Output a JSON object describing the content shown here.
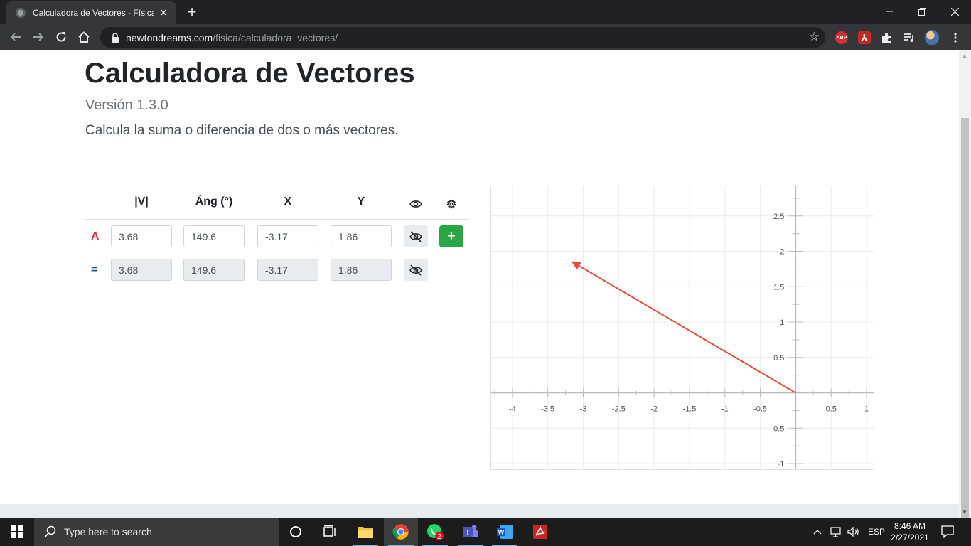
{
  "browser": {
    "tab_title": "Calculadora de Vectores - Física -",
    "url_host": "newtondreams.com",
    "url_path": "/fisica/calculadora_vectores/",
    "abp_label": "ABP"
  },
  "page": {
    "title": "Calculadora de Vectores",
    "version": "Versión 1.3.0",
    "subtitle": "Calcula la suma o diferencia de dos o más vectores."
  },
  "table": {
    "headers": {
      "magnitude": "|V|",
      "angle": "Áng (°)",
      "x": "X",
      "y": "Y"
    },
    "rows": [
      {
        "label": "A",
        "label_color": "#dc3545",
        "magnitude": "3.68",
        "angle": "149.6",
        "x": "-3.17",
        "y": "1.86",
        "readonly": false
      },
      {
        "label": "=",
        "label_color": "#2c5282",
        "magnitude": "3.68",
        "angle": "149.6",
        "x": "-3.17",
        "y": "1.86",
        "readonly": true
      }
    ],
    "add_button": "+"
  },
  "chart_data": {
    "type": "line",
    "title": "",
    "xlabel": "",
    "ylabel": "",
    "xlim": [
      -4.3,
      1.1
    ],
    "ylim": [
      -1.08,
      2.92
    ],
    "x_ticks": [
      "-4",
      "-3.5",
      "-3",
      "-2.5",
      "-2",
      "-1.5",
      "-1",
      "-0.5",
      "0.5",
      "1"
    ],
    "y_ticks": [
      "2.5",
      "2",
      "1.5",
      "1",
      "0.5",
      "-0.5",
      "-1"
    ],
    "grid": true,
    "series": [
      {
        "from": [
          0,
          0
        ],
        "to": [
          -3.17,
          1.86
        ],
        "color": "#e74c3c"
      }
    ]
  },
  "taskbar": {
    "search_placeholder": "Type here to search",
    "whatsapp_badge": "2",
    "lang": "ESP",
    "time": "8:46 AM",
    "date": "2/27/2021"
  }
}
